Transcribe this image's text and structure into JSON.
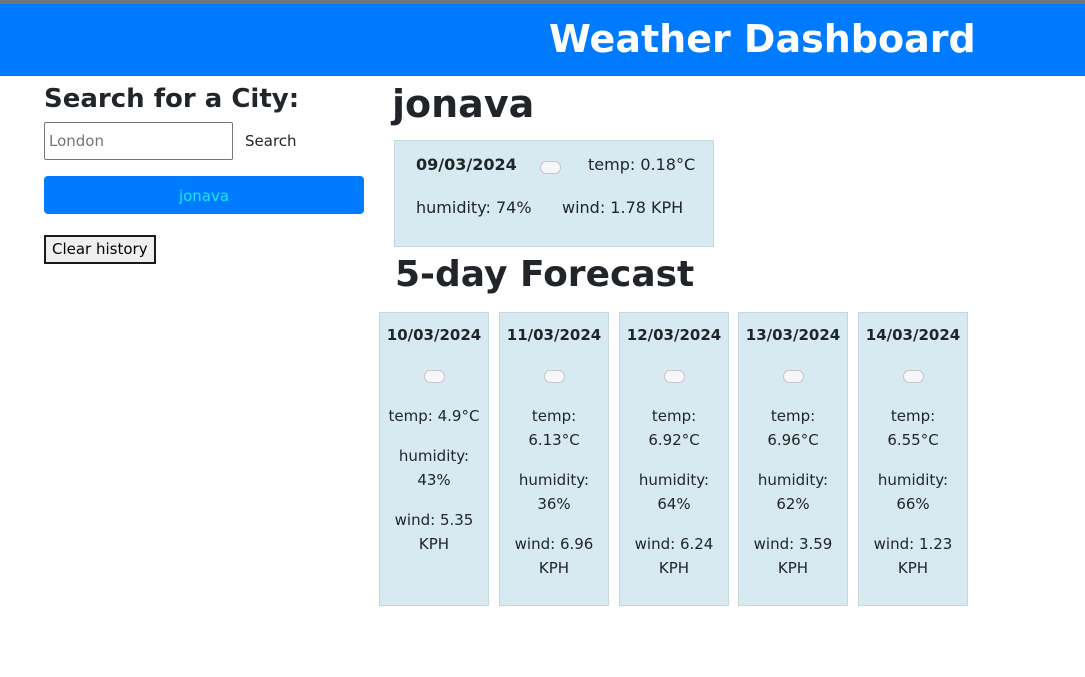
{
  "header": {
    "title": "Weather Dashboard"
  },
  "sidebar": {
    "heading": "Search for a City:",
    "search_placeholder": "London",
    "search_value": "",
    "search_button": "Search",
    "history": [
      "jonava"
    ],
    "clear_button": "Clear history"
  },
  "current": {
    "city": "jonava",
    "date": "09/03/2024",
    "icon": "cloud-icon",
    "temp": "temp: 0.18°C",
    "humidity": "humidity: 74%",
    "wind": "wind: 1.78 KPH"
  },
  "forecast": {
    "heading": "5-day Forecast",
    "days": [
      {
        "date": "10/03/2024",
        "icon": "cloud-icon",
        "temp": "temp: 4.9°C",
        "humidity": "humidity: 43%",
        "wind": "wind: 5.35 KPH"
      },
      {
        "date": "11/03/2024",
        "icon": "cloud-icon",
        "temp": "temp: 6.13°C",
        "humidity": "humidity: 36%",
        "wind": "wind: 6.96 KPH"
      },
      {
        "date": "12/03/2024",
        "icon": "cloud-icon",
        "temp": "temp: 6.92°C",
        "humidity": "humidity: 64%",
        "wind": "wind: 6.24 KPH"
      },
      {
        "date": "13/03/2024",
        "icon": "cloud-icon",
        "temp": "temp: 6.96°C",
        "humidity": "humidity: 62%",
        "wind": "wind: 3.59 KPH"
      },
      {
        "date": "14/03/2024",
        "icon": "cloud-icon",
        "temp": "temp: 6.55°C",
        "humidity": "humidity: 66%",
        "wind": "wind: 1.23 KPH"
      }
    ]
  },
  "colors": {
    "header_bg": "#007bff",
    "card_bg": "#d7eaf1",
    "history_text": "#17e9f2"
  }
}
